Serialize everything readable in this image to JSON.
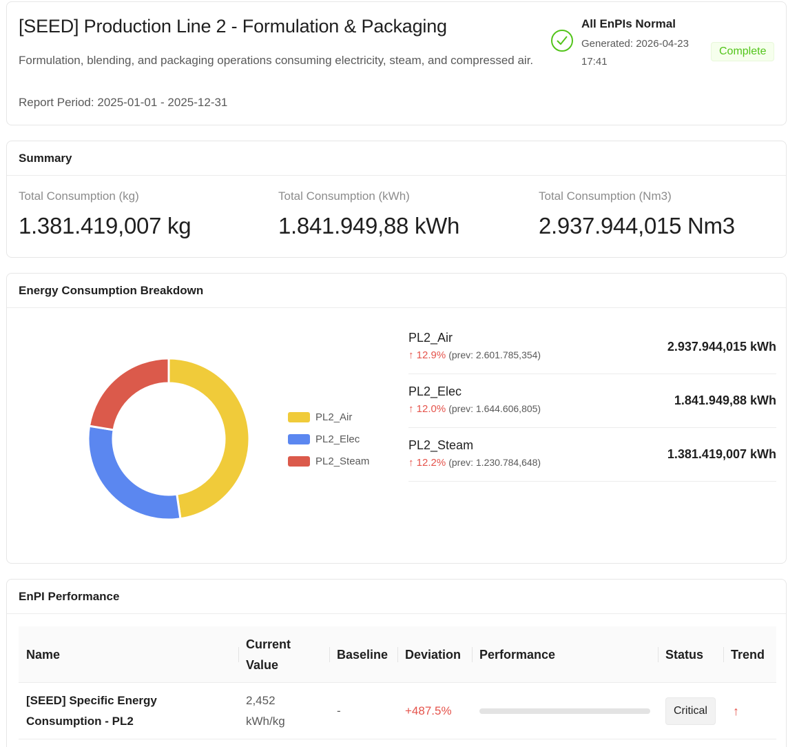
{
  "header": {
    "title": "[SEED] Production Line 2 - Formulation & Packaging",
    "description": "Formulation, blending, and packaging operations consuming electricity, steam, and compressed air.",
    "period_label": "Report Period:",
    "period_value": "2025-01-01 - 2025-12-31",
    "status_title": "All EnPIs Normal",
    "generated": "Generated: 2026-04-23 17:41",
    "complete_tag": "Complete",
    "status_icon": "check-circle-icon"
  },
  "summary": {
    "title": "Summary",
    "items": [
      {
        "label": "Total Consumption (kg)",
        "value": "1.381.419,007",
        "unit": "kg"
      },
      {
        "label": "Total Consumption (kWh)",
        "value": "1.841.949,88",
        "unit": "kWh"
      },
      {
        "label": "Total Consumption (Nm3)",
        "value": "2.937.944,015",
        "unit": "Nm3"
      }
    ]
  },
  "breakdown": {
    "title": "Energy Consumption Breakdown",
    "items": [
      {
        "name": "PL2_Air",
        "change": "12.9%",
        "prev": "(prev: 2.601.785,354)",
        "value": "2.937.944,015 kWh"
      },
      {
        "name": "PL2_Elec",
        "change": "12.0%",
        "prev": "(prev: 1.644.606,805)",
        "value": "1.841.949,88 kWh"
      },
      {
        "name": "PL2_Steam",
        "change": "12.2%",
        "prev": "(prev: 1.230.784,648)",
        "value": "1.381.419,007 kWh"
      }
    ],
    "arrow_icon": "arrow-up-icon"
  },
  "chart_data": {
    "type": "pie",
    "donut": true,
    "categories": [
      "PL2_Air",
      "PL2_Elec",
      "PL2_Steam"
    ],
    "values": [
      2937944.015,
      1841949.88,
      1381419.007
    ],
    "colors": [
      "#f0cb3a",
      "#5b87f0",
      "#db5a4b"
    ],
    "legend": "right"
  },
  "enpi": {
    "title": "EnPI Performance",
    "columns": [
      "Name",
      "Current Value",
      "Baseline",
      "Deviation",
      "Performance",
      "Status",
      "Trend"
    ],
    "rows": [
      {
        "name": "[SEED] Specific Energy Consumption - PL2",
        "current_value": "2,452 kWh/kg",
        "baseline": "-",
        "deviation": "+487.5%",
        "performance": 0,
        "status": "Critical",
        "trend": "↑"
      }
    ],
    "colors": {
      "critical": "#e5534b",
      "ok": "#52c41a"
    }
  }
}
